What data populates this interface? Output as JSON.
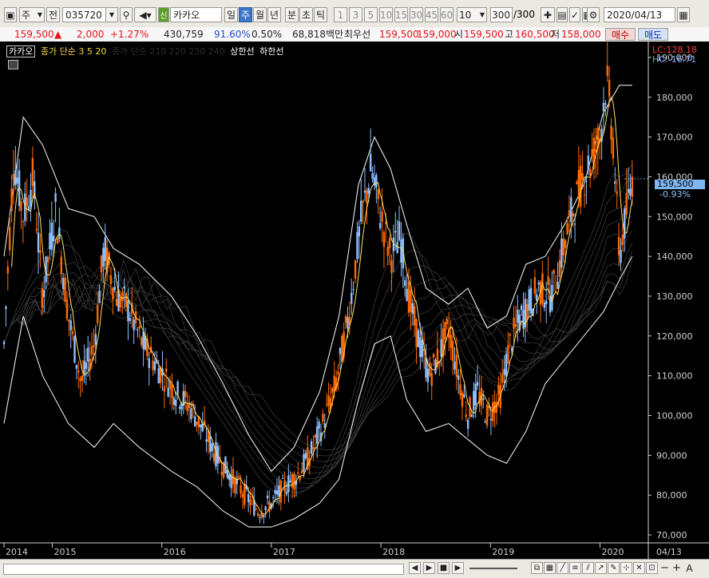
{
  "toolbar": {
    "period_select": "주",
    "prev_label": "전",
    "code": "035720",
    "new_badge": "신",
    "stock_name": "카카오",
    "timeframes": [
      "일",
      "주",
      "월",
      "년",
      "분",
      "초",
      "틱"
    ],
    "selected_timeframe": "주",
    "intervals": [
      "1",
      "3",
      "5",
      "10",
      "15",
      "30",
      "45",
      "60"
    ],
    "interval_select": "10",
    "count_current": "300",
    "count_total": "/300",
    "date": "2020/04/13"
  },
  "quote": {
    "price": "159,500",
    "change": "2,000",
    "change_pct": "+1.27%",
    "volume": "430,759",
    "volume_ratio": "91.60%",
    "turnover": "0.50%",
    "amount": "68,818백만",
    "priority_label": "최우선",
    "ask": "159,500",
    "bid": "159,000",
    "open_label": "시",
    "open": "159,500",
    "high_label": "고",
    "high": "160,500",
    "low_label": "저",
    "low": "158,000",
    "buy_label": "매수",
    "sell_label": "매도"
  },
  "legend": {
    "name": "카카오",
    "ma_label": "종가 단순 3  5  20",
    "ma_long_label": "종가 단순 210  220  230  240",
    "upper_label": "상한선",
    "lower_label": "하한선"
  },
  "readout": {
    "lc": "LC:128.18",
    "hc": "HC:-16.71",
    "current_price": "159,500",
    "current_pct": "-0.93%"
  },
  "colors": {
    "up": "#ff6a00",
    "down": "#8fc0ff",
    "ma": "#ffe066",
    "band": "#ffffff",
    "current_box": "#7db6f0"
  },
  "chart_data": {
    "type": "candlestick",
    "ylim": [
      68000,
      194000
    ],
    "y_ticks": [
      {
        "label": "190,000",
        "v": 190000
      },
      {
        "label": "180,000",
        "v": 180000
      },
      {
        "label": "170,000",
        "v": 170000
      },
      {
        "label": "160,000",
        "v": 160000
      },
      {
        "label": "150,000",
        "v": 150000
      },
      {
        "label": "140,000",
        "v": 140000
      },
      {
        "label": "130,000",
        "v": 130000
      },
      {
        "label": "120,000",
        "v": 120000
      },
      {
        "label": "110,000",
        "v": 110000
      },
      {
        "label": "100,000",
        "v": 100000
      },
      {
        "label": "90,000",
        "v": 90000
      },
      {
        "label": "80,000",
        "v": 80000
      },
      {
        "label": "70,000",
        "v": 70000
      }
    ],
    "x_ticks": [
      {
        "label": "2014",
        "t": 0
      },
      {
        "label": "2015",
        "t": 0.075
      },
      {
        "label": "2016",
        "t": 0.245
      },
      {
        "label": "2017",
        "t": 0.415
      },
      {
        "label": "2018",
        "t": 0.585
      },
      {
        "label": "2019",
        "t": 0.755
      },
      {
        "label": "2020",
        "t": 0.925
      }
    ],
    "x_last_label": "04/13",
    "close_path": [
      [
        0.0,
        118000
      ],
      [
        0.015,
        165000
      ],
      [
        0.03,
        150000
      ],
      [
        0.045,
        160000
      ],
      [
        0.06,
        130000
      ],
      [
        0.08,
        152000
      ],
      [
        0.1,
        125000
      ],
      [
        0.12,
        108000
      ],
      [
        0.14,
        118000
      ],
      [
        0.155,
        142000
      ],
      [
        0.175,
        130000
      ],
      [
        0.19,
        128000
      ],
      [
        0.215,
        118000
      ],
      [
        0.24,
        112000
      ],
      [
        0.265,
        106000
      ],
      [
        0.29,
        102000
      ],
      [
        0.31,
        96000
      ],
      [
        0.33,
        90000
      ],
      [
        0.355,
        84000
      ],
      [
        0.375,
        80000
      ],
      [
        0.395,
        76000
      ],
      [
        0.415,
        78000
      ],
      [
        0.435,
        82000
      ],
      [
        0.455,
        85000
      ],
      [
        0.475,
        90000
      ],
      [
        0.495,
        98000
      ],
      [
        0.515,
        108000
      ],
      [
        0.535,
        125000
      ],
      [
        0.555,
        150000
      ],
      [
        0.57,
        162000
      ],
      [
        0.585,
        150000
      ],
      [
        0.6,
        140000
      ],
      [
        0.615,
        145000
      ],
      [
        0.63,
        128000
      ],
      [
        0.645,
        118000
      ],
      [
        0.66,
        110000
      ],
      [
        0.675,
        115000
      ],
      [
        0.69,
        122000
      ],
      [
        0.705,
        110000
      ],
      [
        0.72,
        100000
      ],
      [
        0.735,
        106000
      ],
      [
        0.75,
        100000
      ],
      [
        0.77,
        105000
      ],
      [
        0.785,
        118000
      ],
      [
        0.8,
        124000
      ],
      [
        0.815,
        128000
      ],
      [
        0.83,
        132000
      ],
      [
        0.85,
        130000
      ],
      [
        0.865,
        140000
      ],
      [
        0.88,
        150000
      ],
      [
        0.895,
        158000
      ],
      [
        0.91,
        164000
      ],
      [
        0.925,
        170000
      ],
      [
        0.935,
        185000
      ],
      [
        0.945,
        170000
      ],
      [
        0.955,
        140000
      ],
      [
        0.965,
        150000
      ],
      [
        0.975,
        159500
      ]
    ],
    "upper_band": [
      [
        0.0,
        140000
      ],
      [
        0.03,
        175000
      ],
      [
        0.06,
        168000
      ],
      [
        0.1,
        152000
      ],
      [
        0.14,
        150000
      ],
      [
        0.17,
        142000
      ],
      [
        0.21,
        138000
      ],
      [
        0.26,
        130000
      ],
      [
        0.3,
        120000
      ],
      [
        0.34,
        108000
      ],
      [
        0.38,
        95000
      ],
      [
        0.415,
        86000
      ],
      [
        0.45,
        92000
      ],
      [
        0.49,
        106000
      ],
      [
        0.52,
        125000
      ],
      [
        0.55,
        158000
      ],
      [
        0.575,
        170000
      ],
      [
        0.6,
        162000
      ],
      [
        0.625,
        148000
      ],
      [
        0.655,
        132000
      ],
      [
        0.69,
        128000
      ],
      [
        0.72,
        132000
      ],
      [
        0.75,
        122000
      ],
      [
        0.78,
        125000
      ],
      [
        0.81,
        138000
      ],
      [
        0.84,
        140000
      ],
      [
        0.87,
        148000
      ],
      [
        0.9,
        158000
      ],
      [
        0.93,
        176000
      ],
      [
        0.955,
        183000
      ],
      [
        0.975,
        183000
      ]
    ],
    "lower_band": [
      [
        0.0,
        98000
      ],
      [
        0.03,
        125000
      ],
      [
        0.06,
        110000
      ],
      [
        0.1,
        98000
      ],
      [
        0.14,
        92000
      ],
      [
        0.17,
        98000
      ],
      [
        0.21,
        92000
      ],
      [
        0.26,
        86000
      ],
      [
        0.3,
        82000
      ],
      [
        0.34,
        76000
      ],
      [
        0.38,
        72000
      ],
      [
        0.415,
        72000
      ],
      [
        0.45,
        74000
      ],
      [
        0.49,
        78000
      ],
      [
        0.52,
        84000
      ],
      [
        0.55,
        104000
      ],
      [
        0.575,
        118000
      ],
      [
        0.6,
        120000
      ],
      [
        0.625,
        104000
      ],
      [
        0.655,
        96000
      ],
      [
        0.69,
        98000
      ],
      [
        0.72,
        94000
      ],
      [
        0.75,
        90000
      ],
      [
        0.78,
        88000
      ],
      [
        0.81,
        96000
      ],
      [
        0.84,
        108000
      ],
      [
        0.87,
        114000
      ],
      [
        0.9,
        120000
      ],
      [
        0.93,
        126000
      ],
      [
        0.955,
        134000
      ],
      [
        0.975,
        140000
      ]
    ],
    "last_price": 159500
  }
}
